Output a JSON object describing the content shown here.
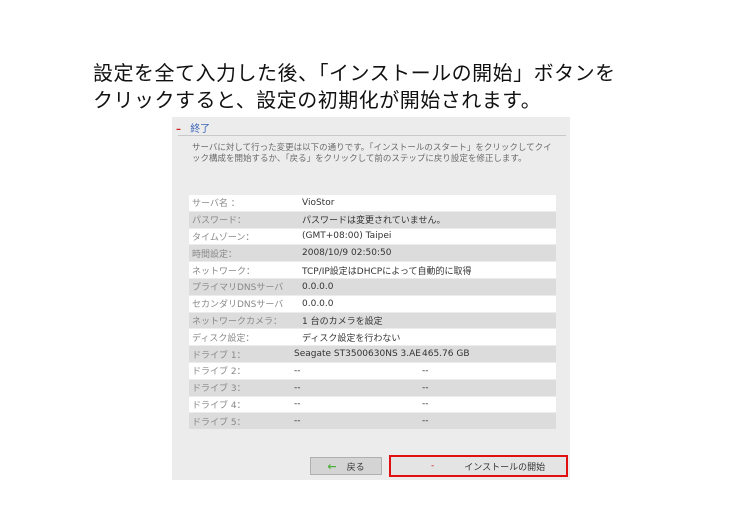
{
  "instruction": {
    "line1": "設定を全て入力した後、「インストールの開始」ボタンを",
    "line2": "クリックすると、設定の初期化が開始されます。"
  },
  "panel": {
    "title": "終了",
    "description": "サーバに対して行った変更は以下の通りです。「インストールのスタート」をクリックしてクイック構成を開始するか、「戻る」をクリックして前のステップに戻り設定を修正します。"
  },
  "summary": [
    {
      "label": "サーバ名 ：",
      "value": "VioStor"
    },
    {
      "label": "パスワード：",
      "value": "パスワードは変更されていません。"
    },
    {
      "label": "タイムゾーン：",
      "value": "(GMT+08:00) Taipei"
    },
    {
      "label": "時間設定：",
      "value": "2008/10/9 02:50:50"
    },
    {
      "label": "ネットワーク：",
      "value": "TCP/IP設定はDHCPによって自動的に取得"
    },
    {
      "label": "プライマリDNSサーバ",
      "value": "0.0.0.0"
    },
    {
      "label": "セカンダリDNSサーバ",
      "value": "0.0.0.0"
    },
    {
      "label": "ネットワークカメラ：",
      "value": "1 台のカメラを設定"
    },
    {
      "label": "ディスク設定：",
      "value": "ディスク設定を行わない"
    }
  ],
  "drives": [
    {
      "label": "ドライブ 1：",
      "model": "Seagate ST3500630NS 3.AE",
      "size": "465.76 GB"
    },
    {
      "label": "ドライブ 2：",
      "model": "--",
      "size": "--"
    },
    {
      "label": "ドライブ 3：",
      "model": "--",
      "size": "--"
    },
    {
      "label": "ドライブ 4：",
      "model": "--",
      "size": "--"
    },
    {
      "label": "ドライブ 5：",
      "model": "--",
      "size": "--"
    }
  ],
  "buttons": {
    "back": "戻る",
    "install": "インストールの開始"
  },
  "icons": {
    "back": "arrow-left-icon",
    "install": "dash-icon",
    "collapse": "minus-icon"
  }
}
